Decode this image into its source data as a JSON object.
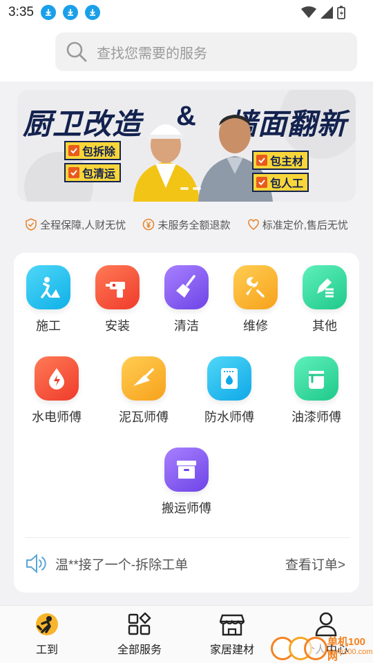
{
  "status": {
    "time": "3:35"
  },
  "search": {
    "placeholder": "查找您需要的服务"
  },
  "banner": {
    "title_left": "厨卫改造",
    "amp": "&",
    "title_right": "墙面翻新",
    "tags_left": [
      "包拆除",
      "包清运"
    ],
    "tags_right": [
      "包主材",
      "包人工"
    ]
  },
  "guarantees": [
    {
      "icon": "shield-check-icon",
      "label": "全程保障,人财无忧"
    },
    {
      "icon": "yen-circle-icon",
      "label": "未服务全额退款"
    },
    {
      "icon": "heart-icon",
      "label": "标准定价,售后无忧"
    }
  ],
  "services_row1": [
    {
      "label": "施工",
      "icon": "construction-worker-icon",
      "color": "#1ec3f0"
    },
    {
      "label": "安装",
      "icon": "drill-icon",
      "color": "#f5553c"
    },
    {
      "label": "清洁",
      "icon": "broom-icon",
      "color": "#8a5cf0"
    },
    {
      "label": "维修",
      "icon": "wrench-icon",
      "color": "#fbb22f"
    },
    {
      "label": "其他",
      "icon": "edit-list-icon",
      "color": "#2ed59a"
    }
  ],
  "services_row2": [
    {
      "label": "水电师傅",
      "icon": "power-drop-icon",
      "color": "#f5553c"
    },
    {
      "label": "泥瓦师傅",
      "icon": "trowel-icon",
      "color": "#fbb22f"
    },
    {
      "label": "防水师傅",
      "icon": "waterproof-icon",
      "color": "#19b9f0"
    },
    {
      "label": "油漆师傅",
      "icon": "paint-bucket-icon",
      "color": "#2ed59a"
    }
  ],
  "services_row3": [
    {
      "label": "搬运师傅",
      "icon": "box-icon",
      "color": "#8a5cf0"
    }
  ],
  "notice": {
    "text": "温**接了一个-拆除工单",
    "link": "查看订单>"
  },
  "tabs": [
    {
      "label": "工到",
      "icon": "app-logo-icon"
    },
    {
      "label": "全部服务",
      "icon": "grid-icon"
    },
    {
      "label": "家居建材",
      "icon": "store-icon"
    },
    {
      "label": "个人中心",
      "icon": "user-icon"
    }
  ],
  "watermark": {
    "text": "单机100网",
    "url": "danji100.com"
  }
}
